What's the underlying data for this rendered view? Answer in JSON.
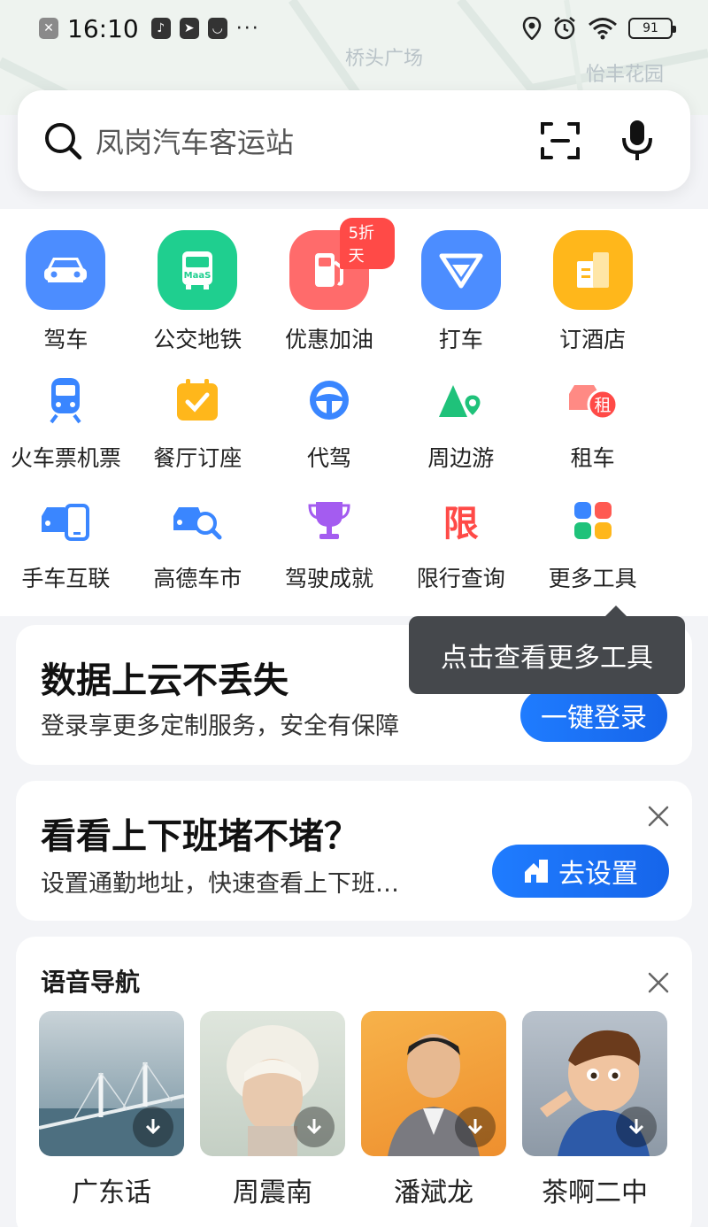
{
  "status_bar": {
    "time": "16:10",
    "battery": "91",
    "overflow": "···"
  },
  "map": {
    "labels": [
      "桥头广场",
      "怡丰花园"
    ]
  },
  "search": {
    "placeholder": "凤岗汽车客运站"
  },
  "tools": [
    {
      "label": "驾车",
      "icon": "car-icon",
      "color": "#4c8dff"
    },
    {
      "label": "公交地铁",
      "icon": "bus-icon",
      "color": "#1fcf8f"
    },
    {
      "label": "优惠加油",
      "icon": "fuel-pump-icon",
      "color": "#ff6b6b",
      "badge": "5折天"
    },
    {
      "label": "打车",
      "icon": "taxi-icon",
      "color": "#4c8dff"
    },
    {
      "label": "订酒店",
      "icon": "hotel-icon",
      "color": "#ffb71b"
    },
    {
      "label": "火车票机票",
      "icon": "train-icon",
      "color": "#3a86ff"
    },
    {
      "label": "餐厅订座",
      "icon": "calendar-check-icon",
      "color": "#ffb71b"
    },
    {
      "label": "代驾",
      "icon": "steering-wheel-icon",
      "color": "#3a86ff"
    },
    {
      "label": "周边游",
      "icon": "mountain-pin-icon",
      "color": "#1fc27a"
    },
    {
      "label": "租车",
      "icon": "car-rental-icon",
      "color": "#ff5a52",
      "mark": "租"
    },
    {
      "label": "手车互联",
      "icon": "phone-car-icon",
      "color": "#3a86ff"
    },
    {
      "label": "高德车市",
      "icon": "car-search-icon",
      "color": "#3a86ff"
    },
    {
      "label": "驾驶成就",
      "icon": "trophy-icon",
      "color": "#a45cf0"
    },
    {
      "label": "限行查询",
      "icon": "restriction-icon",
      "color": "#ff4a47",
      "mark": "限"
    },
    {
      "label": "更多工具",
      "icon": "grid-icon",
      "color": "#3a86ff"
    }
  ],
  "tooltip": {
    "text": "点击查看更多工具"
  },
  "login_card": {
    "title": "数据上云不丢失",
    "subtitle": "登录享更多定制服务，安全有保障",
    "button": "一键登录"
  },
  "commute_card": {
    "title": "看看上下班堵不堵？",
    "subtitle": "设置通勤地址，快速查看上下班…",
    "button": "去设置"
  },
  "voice_nav": {
    "title": "语音导航",
    "items": [
      {
        "name": "广东话"
      },
      {
        "name": "周震南"
      },
      {
        "name": "潘斌龙"
      },
      {
        "name": "茶啊二中"
      }
    ]
  }
}
